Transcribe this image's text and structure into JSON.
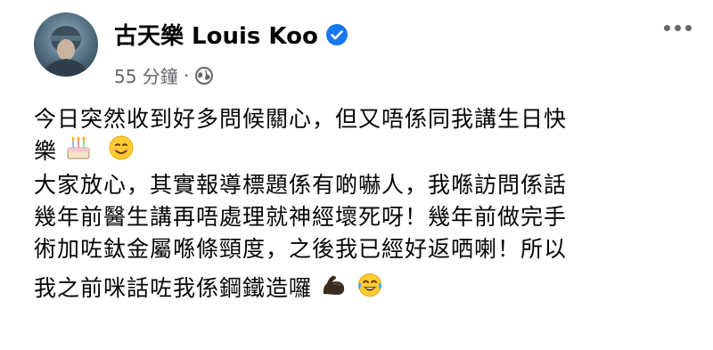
{
  "post": {
    "author": "古天樂 Louis Koo",
    "timestamp": "55 分鐘",
    "separator": "·",
    "privacy_icon": "globe-icon",
    "verified_icon": "verified-badge-icon",
    "more_icon": "more-options-icon",
    "lines": [
      "今日突然收到好多問候關心，但又唔係同我講生日快",
      "樂",
      "大家放心，其實報導標題係有啲嚇人，我喺訪問係話",
      "幾年前醫生講再唔處理就神經壞死呀！幾年前做完手",
      "術加咗鈦金屬喺條頸度，之後我已經好返哂喇！所以",
      "我之前咪話咗我係鋼鐵造囉"
    ],
    "emojis": {
      "line2": [
        "birthday-cake-emoji",
        "smiling-face-emoji"
      ],
      "line6": [
        "flexed-biceps-emoji",
        "face-with-tears-of-joy-emoji"
      ]
    }
  },
  "colors": {
    "verified_blue": "#1877f2",
    "meta_gray": "#65676b",
    "text": "#050505"
  }
}
